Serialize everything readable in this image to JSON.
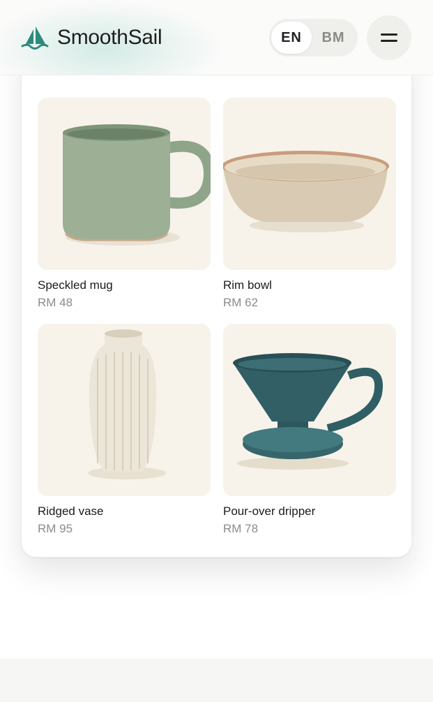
{
  "header": {
    "brand": "SmoothSail",
    "logo_icon": "sailboat-icon",
    "language": {
      "options": [
        "EN",
        "BM"
      ],
      "selected": "EN"
    },
    "menu_icon": "menu-icon"
  },
  "products": [
    {
      "name": "Speckled mug",
      "price": "RM 48",
      "image": "speckled-mug"
    },
    {
      "name": "Rim bowl",
      "price": "RM 62",
      "image": "rim-bowl"
    },
    {
      "name": "Ridged vase",
      "price": "RM 95",
      "image": "ridged-vase"
    },
    {
      "name": "Pour-over dripper",
      "price": "RM 78",
      "image": "pour-over-dripper"
    }
  ],
  "colors": {
    "accent": "#2f8a7c",
    "card_bg": "#ffffff",
    "photo_bg": "#f7f3ea",
    "price_text": "#8b8b88"
  }
}
